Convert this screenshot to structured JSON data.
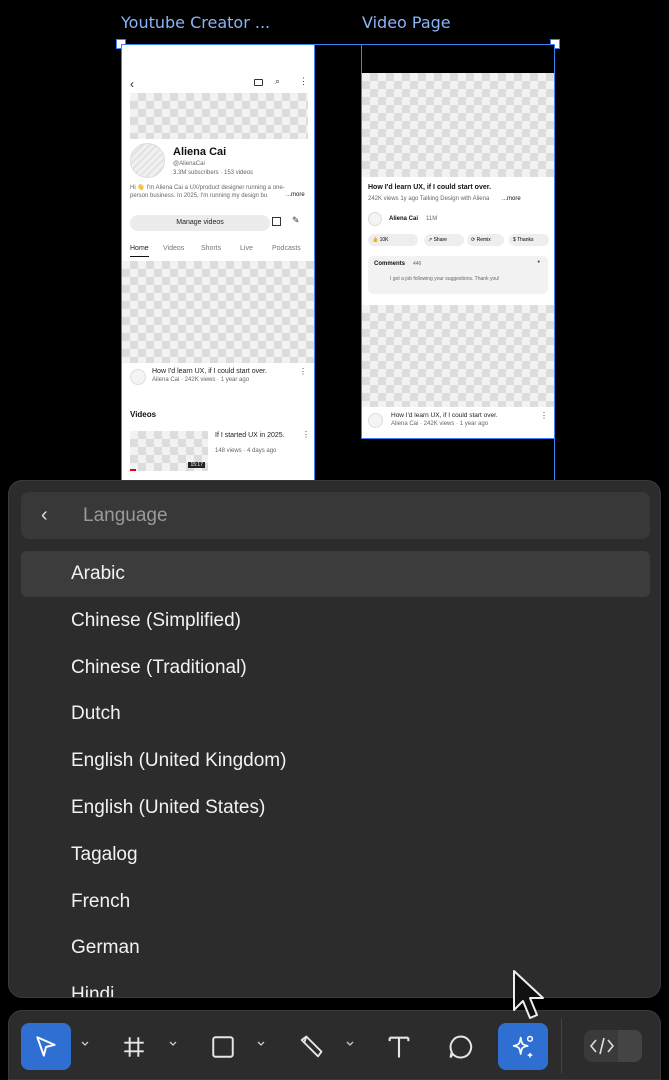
{
  "canvas": {
    "frame1_title": "Youtube Creator ...",
    "frame2_title": "Video Page",
    "channel": {
      "name": "Aliena Cai",
      "handle": "@AlienaCai",
      "stats": "3.3M subscribers · 153 videos",
      "bio": "Hi 👋 I'm Aliena Cai a UX/product designer running a one-person business. In 2025, I'm running my design bu",
      "more": "...more",
      "manage_btn": "Manage videos",
      "tabs": [
        "Home",
        "Videos",
        "Shorts",
        "Live",
        "Podcasts"
      ],
      "featured_title": "How I'd learn UX, if I could start over.",
      "featured_meta": "Aliena Cai · 242K views · 1 year ago",
      "videos_heading": "Videos",
      "video_title": "If I started UX in 2025.",
      "video_meta": "148 views · 4 days ago",
      "video_duration": "15:17"
    },
    "video_page": {
      "title": "How I'd learn UX, if I could start over.",
      "meta": "242K views 1y ago Talking Design with Aliena",
      "more": "...more",
      "channel": "Aliena Cai",
      "subs": "11M",
      "likes": "10K",
      "share": "Share",
      "remix": "Remix",
      "thanks": "Thanks",
      "comments_label": "Comments",
      "comments_count": "446",
      "comment": "I got a job following your suggestions. Thank you!",
      "next_title": "How I'd learn UX, if I could start over.",
      "next_meta": "Aliena Cai · 242K views · 1 year ago"
    }
  },
  "dropdown": {
    "placeholder": "Language",
    "languages": [
      "Arabic",
      "Chinese (Simplified)",
      "Chinese (Traditional)",
      "Dutch",
      "English (United Kingdom)",
      "English (United States)",
      "Tagalog",
      "French",
      "German",
      "Hindi"
    ],
    "active_index": 0
  },
  "toolbar": {
    "tools": [
      "move-tool",
      "frame-tool",
      "shape-tool",
      "pen-tool",
      "text-tool",
      "comment-tool",
      "ai-tool",
      "dev-mode-toggle"
    ],
    "accent": "#2f6fd1"
  }
}
